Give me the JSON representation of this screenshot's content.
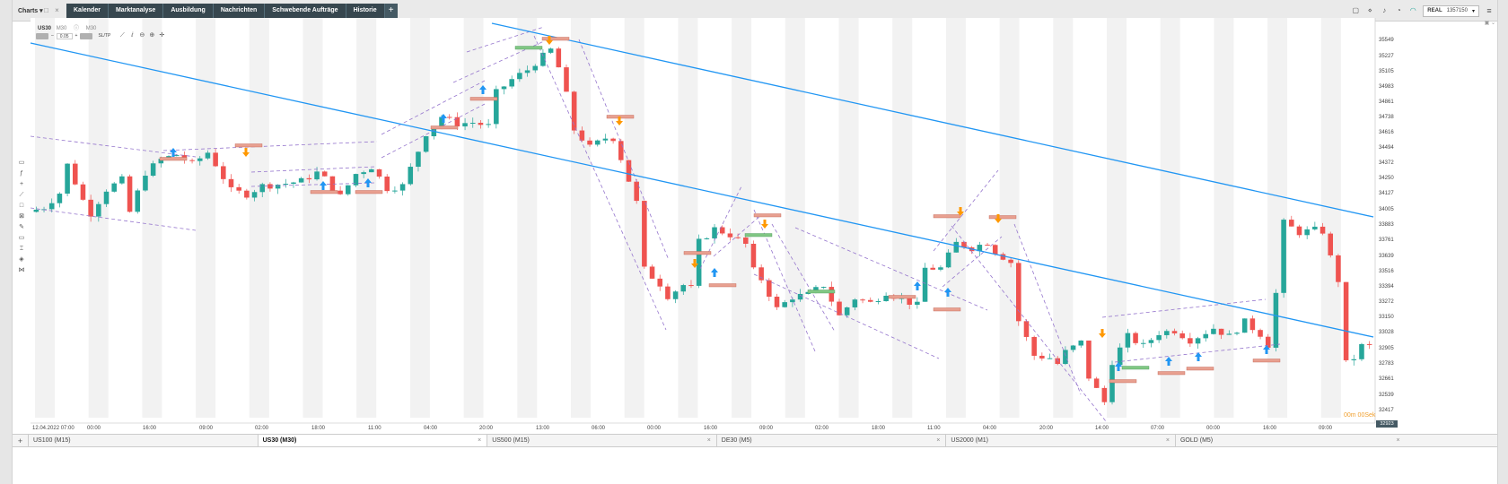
{
  "nav": {
    "charts_label": "Charts",
    "tabs": [
      "Kalender",
      "Marktanalyse",
      "Ausbildung",
      "Nachrichten",
      "Schwebende Aufträge",
      "Historie"
    ],
    "plus": "+",
    "account_mode": "REAL",
    "account_number": "1357150"
  },
  "symbol": {
    "name": "US30",
    "timeframe": "M30",
    "suffix": "M30",
    "order_bar": {
      "sell": "",
      "lot": "0.05",
      "buy": "",
      "sltp": "SL/TP"
    }
  },
  "axis": {
    "price_labels": [
      "35549",
      "35227",
      "35105",
      "34983",
      "34861",
      "34738",
      "34616",
      "34494",
      "34372",
      "34250",
      "34127",
      "34005",
      "33883",
      "33761",
      "33639",
      "33516",
      "33394",
      "33272",
      "33150",
      "33028",
      "32905",
      "32783",
      "32661",
      "32539",
      "32417"
    ],
    "time_labels": [
      "12.04.2022 07:00",
      "00:00",
      "16:00",
      "09:00",
      "02:00",
      "18:00",
      "11:00",
      "04:00",
      "20:00",
      "13:00",
      "06:00",
      "00:00",
      "16:00",
      "09:00",
      "02:00",
      "18:00",
      "11:00",
      "04:00",
      "20:00",
      "14:00",
      "07:00",
      "00:00",
      "16:00",
      "09:00"
    ],
    "current_price": "32923",
    "candle_timer": "00m 00Sek"
  },
  "bottom_tabs": [
    {
      "label": "US100 (M15)",
      "active": false
    },
    {
      "label": "US30 (M30)",
      "active": true
    },
    {
      "label": "US500 (M15)",
      "active": false
    },
    {
      "label": "DE30 (M5)",
      "active": false
    },
    {
      "label": "US2000 (M1)",
      "active": false
    },
    {
      "label": "GOLD (M5)",
      "active": false
    }
  ],
  "colors": {
    "up": "#26a69a",
    "down": "#ef5350",
    "trendline": "#2196f3",
    "channel": "#9575cd",
    "buy_arrow": "#2196f3",
    "sell_arrow": "#ff9800",
    "order_sell": "#e8a090",
    "order_buy": "#81c784"
  },
  "chart_data": {
    "type": "candlestick",
    "symbol": "US30",
    "timeframe": "M30",
    "ylim": [
      32350,
      35650
    ],
    "path": [
      [
        0,
        34072
      ],
      [
        2,
        34110
      ],
      [
        4,
        34230
      ],
      [
        5,
        34466
      ],
      [
        7,
        34170
      ],
      [
        8,
        34060
      ],
      [
        10,
        34260
      ],
      [
        12,
        34340
      ],
      [
        13,
        34070
      ],
      [
        15,
        34400
      ],
      [
        17,
        34510
      ],
      [
        19,
        34550
      ],
      [
        21,
        34470
      ],
      [
        23,
        34570
      ],
      [
        24,
        34470
      ],
      [
        26,
        34250
      ],
      [
        28,
        34220
      ],
      [
        30,
        34290
      ],
      [
        33,
        34310
      ],
      [
        35,
        34330
      ],
      [
        37,
        34400
      ],
      [
        38,
        34350
      ],
      [
        40,
        34200
      ],
      [
        42,
        34390
      ],
      [
        44,
        34450
      ],
      [
        46,
        34270
      ],
      [
        48,
        34290
      ],
      [
        51,
        34730
      ],
      [
        53,
        34870
      ],
      [
        55,
        34810
      ],
      [
        57,
        34820
      ],
      [
        59,
        34790
      ],
      [
        60,
        35070
      ],
      [
        62,
        35180
      ],
      [
        64,
        35260
      ],
      [
        65,
        35320
      ],
      [
        67,
        35428
      ],
      [
        68,
        35280
      ],
      [
        69,
        35050
      ],
      [
        70,
        34760
      ],
      [
        72,
        34610
      ],
      [
        74,
        34690
      ],
      [
        75,
        34690
      ],
      [
        76,
        34520
      ],
      [
        78,
        34150
      ],
      [
        79,
        33590
      ],
      [
        81,
        33470
      ],
      [
        82,
        33370
      ],
      [
        84,
        33460
      ],
      [
        85,
        33430
      ],
      [
        86,
        33820
      ],
      [
        88,
        33930
      ],
      [
        90,
        33880
      ],
      [
        92,
        33800
      ],
      [
        93,
        33580
      ],
      [
        94,
        33510
      ],
      [
        96,
        33260
      ],
      [
        98,
        33360
      ],
      [
        100,
        33380
      ],
      [
        102,
        33460
      ],
      [
        104,
        33200
      ],
      [
        106,
        33350
      ],
      [
        108,
        33310
      ],
      [
        110,
        33400
      ],
      [
        112,
        33340
      ],
      [
        114,
        33290
      ],
      [
        115,
        33600
      ],
      [
        117,
        33600
      ],
      [
        119,
        33810
      ],
      [
        121,
        33770
      ],
      [
        123,
        33820
      ],
      [
        124,
        33740
      ],
      [
        126,
        33650
      ],
      [
        127,
        33160
      ],
      [
        129,
        32870
      ],
      [
        131,
        32850
      ],
      [
        132,
        32800
      ],
      [
        133,
        32900
      ],
      [
        135,
        32980
      ],
      [
        136,
        32690
      ],
      [
        138,
        32480
      ],
      [
        139,
        32820
      ],
      [
        141,
        33030
      ],
      [
        143,
        32950
      ],
      [
        145,
        33060
      ],
      [
        147,
        33080
      ],
      [
        149,
        33000
      ],
      [
        150,
        33030
      ],
      [
        152,
        33100
      ],
      [
        154,
        33030
      ],
      [
        156,
        33150
      ],
      [
        158,
        33050
      ],
      [
        159,
        32960
      ],
      [
        160,
        33390
      ],
      [
        161,
        33980
      ],
      [
        163,
        33900
      ],
      [
        165,
        33920
      ],
      [
        166,
        33910
      ],
      [
        167,
        33690
      ],
      [
        168,
        33500
      ],
      [
        168.5,
        32780
      ],
      [
        170,
        32850
      ],
      [
        171,
        32950
      ]
    ],
    "channel_lines": 16,
    "blue_trendlines": 2,
    "signals": {
      "buy_arrows": 16,
      "sell_arrows": 7,
      "order_bars": 27
    }
  }
}
